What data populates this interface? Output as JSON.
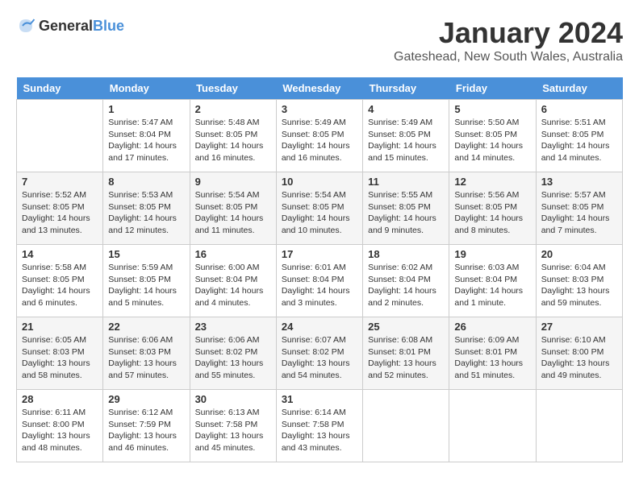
{
  "header": {
    "logo": {
      "general": "General",
      "blue": "Blue"
    },
    "title": "January 2024",
    "subtitle": "Gateshead, New South Wales, Australia"
  },
  "days_of_week": [
    "Sunday",
    "Monday",
    "Tuesday",
    "Wednesday",
    "Thursday",
    "Friday",
    "Saturday"
  ],
  "weeks": [
    [
      {
        "day": "",
        "info": ""
      },
      {
        "day": "1",
        "info": "Sunrise: 5:47 AM\nSunset: 8:04 PM\nDaylight: 14 hours\nand 17 minutes."
      },
      {
        "day": "2",
        "info": "Sunrise: 5:48 AM\nSunset: 8:05 PM\nDaylight: 14 hours\nand 16 minutes."
      },
      {
        "day": "3",
        "info": "Sunrise: 5:49 AM\nSunset: 8:05 PM\nDaylight: 14 hours\nand 16 minutes."
      },
      {
        "day": "4",
        "info": "Sunrise: 5:49 AM\nSunset: 8:05 PM\nDaylight: 14 hours\nand 15 minutes."
      },
      {
        "day": "5",
        "info": "Sunrise: 5:50 AM\nSunset: 8:05 PM\nDaylight: 14 hours\nand 14 minutes."
      },
      {
        "day": "6",
        "info": "Sunrise: 5:51 AM\nSunset: 8:05 PM\nDaylight: 14 hours\nand 14 minutes."
      }
    ],
    [
      {
        "day": "7",
        "info": "Sunrise: 5:52 AM\nSunset: 8:05 PM\nDaylight: 14 hours\nand 13 minutes."
      },
      {
        "day": "8",
        "info": "Sunrise: 5:53 AM\nSunset: 8:05 PM\nDaylight: 14 hours\nand 12 minutes."
      },
      {
        "day": "9",
        "info": "Sunrise: 5:54 AM\nSunset: 8:05 PM\nDaylight: 14 hours\nand 11 minutes."
      },
      {
        "day": "10",
        "info": "Sunrise: 5:54 AM\nSunset: 8:05 PM\nDaylight: 14 hours\nand 10 minutes."
      },
      {
        "day": "11",
        "info": "Sunrise: 5:55 AM\nSunset: 8:05 PM\nDaylight: 14 hours\nand 9 minutes."
      },
      {
        "day": "12",
        "info": "Sunrise: 5:56 AM\nSunset: 8:05 PM\nDaylight: 14 hours\nand 8 minutes."
      },
      {
        "day": "13",
        "info": "Sunrise: 5:57 AM\nSunset: 8:05 PM\nDaylight: 14 hours\nand 7 minutes."
      }
    ],
    [
      {
        "day": "14",
        "info": "Sunrise: 5:58 AM\nSunset: 8:05 PM\nDaylight: 14 hours\nand 6 minutes."
      },
      {
        "day": "15",
        "info": "Sunrise: 5:59 AM\nSunset: 8:05 PM\nDaylight: 14 hours\nand 5 minutes."
      },
      {
        "day": "16",
        "info": "Sunrise: 6:00 AM\nSunset: 8:04 PM\nDaylight: 14 hours\nand 4 minutes."
      },
      {
        "day": "17",
        "info": "Sunrise: 6:01 AM\nSunset: 8:04 PM\nDaylight: 14 hours\nand 3 minutes."
      },
      {
        "day": "18",
        "info": "Sunrise: 6:02 AM\nSunset: 8:04 PM\nDaylight: 14 hours\nand 2 minutes."
      },
      {
        "day": "19",
        "info": "Sunrise: 6:03 AM\nSunset: 8:04 PM\nDaylight: 14 hours\nand 1 minute."
      },
      {
        "day": "20",
        "info": "Sunrise: 6:04 AM\nSunset: 8:03 PM\nDaylight: 13 hours\nand 59 minutes."
      }
    ],
    [
      {
        "day": "21",
        "info": "Sunrise: 6:05 AM\nSunset: 8:03 PM\nDaylight: 13 hours\nand 58 minutes."
      },
      {
        "day": "22",
        "info": "Sunrise: 6:06 AM\nSunset: 8:03 PM\nDaylight: 13 hours\nand 57 minutes."
      },
      {
        "day": "23",
        "info": "Sunrise: 6:06 AM\nSunset: 8:02 PM\nDaylight: 13 hours\nand 55 minutes."
      },
      {
        "day": "24",
        "info": "Sunrise: 6:07 AM\nSunset: 8:02 PM\nDaylight: 13 hours\nand 54 minutes."
      },
      {
        "day": "25",
        "info": "Sunrise: 6:08 AM\nSunset: 8:01 PM\nDaylight: 13 hours\nand 52 minutes."
      },
      {
        "day": "26",
        "info": "Sunrise: 6:09 AM\nSunset: 8:01 PM\nDaylight: 13 hours\nand 51 minutes."
      },
      {
        "day": "27",
        "info": "Sunrise: 6:10 AM\nSunset: 8:00 PM\nDaylight: 13 hours\nand 49 minutes."
      }
    ],
    [
      {
        "day": "28",
        "info": "Sunrise: 6:11 AM\nSunset: 8:00 PM\nDaylight: 13 hours\nand 48 minutes."
      },
      {
        "day": "29",
        "info": "Sunrise: 6:12 AM\nSunset: 7:59 PM\nDaylight: 13 hours\nand 46 minutes."
      },
      {
        "day": "30",
        "info": "Sunrise: 6:13 AM\nSunset: 7:58 PM\nDaylight: 13 hours\nand 45 minutes."
      },
      {
        "day": "31",
        "info": "Sunrise: 6:14 AM\nSunset: 7:58 PM\nDaylight: 13 hours\nand 43 minutes."
      },
      {
        "day": "",
        "info": ""
      },
      {
        "day": "",
        "info": ""
      },
      {
        "day": "",
        "info": ""
      }
    ]
  ]
}
